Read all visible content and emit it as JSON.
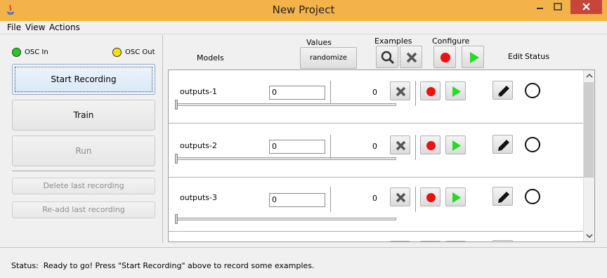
{
  "window": {
    "title": "New Project"
  },
  "menu": [
    "File",
    "View",
    "Actions"
  ],
  "osc": {
    "in_label": "OSC In",
    "in_color": "#22cc22",
    "out_label": "OSC Out",
    "out_color": "#f2e600"
  },
  "left_buttons": {
    "start_recording": "Start Recording",
    "train": "Train",
    "run": "Run",
    "delete_last": "Delete last recording",
    "readd_last": "Re-add last recording"
  },
  "header": {
    "models": "Models",
    "values": "Values",
    "randomize": "randomize",
    "examples": "Examples",
    "configure": "Configure",
    "edit": "Edit",
    "status": "Status"
  },
  "rows": [
    {
      "name": "outputs-1",
      "value": "0",
      "count": "0"
    },
    {
      "name": "outputs-2",
      "value": "0",
      "count": "0"
    },
    {
      "name": "outputs-3",
      "value": "0",
      "count": "0"
    }
  ],
  "statusbar": {
    "text": "Status:  Ready to go! Press \"Start Recording\" above to record some examples."
  },
  "colors": {
    "titlebar": "#f4b34a",
    "record": "#ee1111",
    "play": "#22dd22"
  },
  "icons": [
    "app-icon",
    "minimize-icon",
    "maximize-icon",
    "close-icon",
    "search-icon",
    "x-icon",
    "record-icon",
    "play-icon",
    "pencil-icon",
    "status-circle-icon"
  ]
}
